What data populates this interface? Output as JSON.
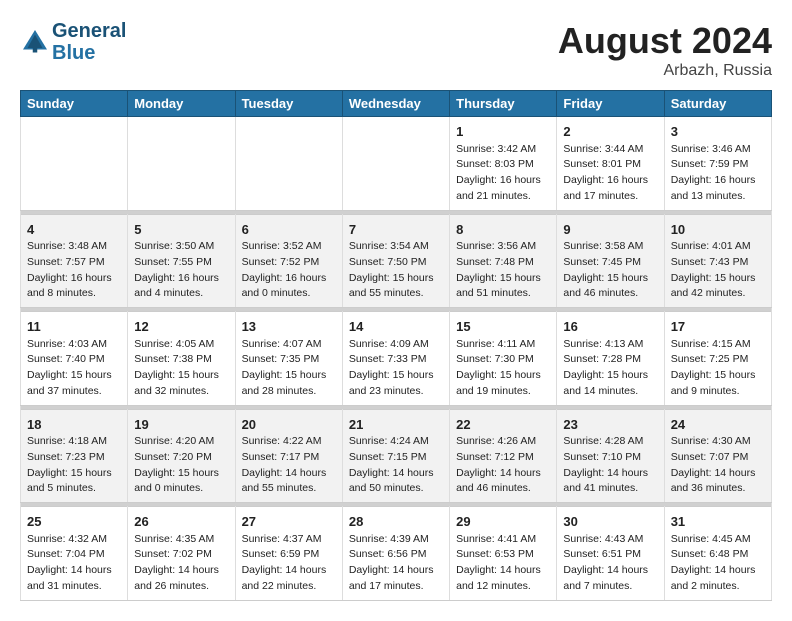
{
  "header": {
    "logo_line1": "General",
    "logo_line2": "Blue",
    "month": "August 2024",
    "location": "Arbazh, Russia"
  },
  "days_of_week": [
    "Sunday",
    "Monday",
    "Tuesday",
    "Wednesday",
    "Thursday",
    "Friday",
    "Saturday"
  ],
  "weeks": [
    {
      "cells": [
        {
          "day": null,
          "content": null
        },
        {
          "day": null,
          "content": null
        },
        {
          "day": null,
          "content": null
        },
        {
          "day": null,
          "content": null
        },
        {
          "day": "1",
          "sunrise": "Sunrise: 3:42 AM",
          "sunset": "Sunset: 8:03 PM",
          "daylight": "Daylight: 16 hours and 21 minutes."
        },
        {
          "day": "2",
          "sunrise": "Sunrise: 3:44 AM",
          "sunset": "Sunset: 8:01 PM",
          "daylight": "Daylight: 16 hours and 17 minutes."
        },
        {
          "day": "3",
          "sunrise": "Sunrise: 3:46 AM",
          "sunset": "Sunset: 7:59 PM",
          "daylight": "Daylight: 16 hours and 13 minutes."
        }
      ]
    },
    {
      "cells": [
        {
          "day": "4",
          "sunrise": "Sunrise: 3:48 AM",
          "sunset": "Sunset: 7:57 PM",
          "daylight": "Daylight: 16 hours and 8 minutes."
        },
        {
          "day": "5",
          "sunrise": "Sunrise: 3:50 AM",
          "sunset": "Sunset: 7:55 PM",
          "daylight": "Daylight: 16 hours and 4 minutes."
        },
        {
          "day": "6",
          "sunrise": "Sunrise: 3:52 AM",
          "sunset": "Sunset: 7:52 PM",
          "daylight": "Daylight: 16 hours and 0 minutes."
        },
        {
          "day": "7",
          "sunrise": "Sunrise: 3:54 AM",
          "sunset": "Sunset: 7:50 PM",
          "daylight": "Daylight: 15 hours and 55 minutes."
        },
        {
          "day": "8",
          "sunrise": "Sunrise: 3:56 AM",
          "sunset": "Sunset: 7:48 PM",
          "daylight": "Daylight: 15 hours and 51 minutes."
        },
        {
          "day": "9",
          "sunrise": "Sunrise: 3:58 AM",
          "sunset": "Sunset: 7:45 PM",
          "daylight": "Daylight: 15 hours and 46 minutes."
        },
        {
          "day": "10",
          "sunrise": "Sunrise: 4:01 AM",
          "sunset": "Sunset: 7:43 PM",
          "daylight": "Daylight: 15 hours and 42 minutes."
        }
      ]
    },
    {
      "cells": [
        {
          "day": "11",
          "sunrise": "Sunrise: 4:03 AM",
          "sunset": "Sunset: 7:40 PM",
          "daylight": "Daylight: 15 hours and 37 minutes."
        },
        {
          "day": "12",
          "sunrise": "Sunrise: 4:05 AM",
          "sunset": "Sunset: 7:38 PM",
          "daylight": "Daylight: 15 hours and 32 minutes."
        },
        {
          "day": "13",
          "sunrise": "Sunrise: 4:07 AM",
          "sunset": "Sunset: 7:35 PM",
          "daylight": "Daylight: 15 hours and 28 minutes."
        },
        {
          "day": "14",
          "sunrise": "Sunrise: 4:09 AM",
          "sunset": "Sunset: 7:33 PM",
          "daylight": "Daylight: 15 hours and 23 minutes."
        },
        {
          "day": "15",
          "sunrise": "Sunrise: 4:11 AM",
          "sunset": "Sunset: 7:30 PM",
          "daylight": "Daylight: 15 hours and 19 minutes."
        },
        {
          "day": "16",
          "sunrise": "Sunrise: 4:13 AM",
          "sunset": "Sunset: 7:28 PM",
          "daylight": "Daylight: 15 hours and 14 minutes."
        },
        {
          "day": "17",
          "sunrise": "Sunrise: 4:15 AM",
          "sunset": "Sunset: 7:25 PM",
          "daylight": "Daylight: 15 hours and 9 minutes."
        }
      ]
    },
    {
      "cells": [
        {
          "day": "18",
          "sunrise": "Sunrise: 4:18 AM",
          "sunset": "Sunset: 7:23 PM",
          "daylight": "Daylight: 15 hours and 5 minutes."
        },
        {
          "day": "19",
          "sunrise": "Sunrise: 4:20 AM",
          "sunset": "Sunset: 7:20 PM",
          "daylight": "Daylight: 15 hours and 0 minutes."
        },
        {
          "day": "20",
          "sunrise": "Sunrise: 4:22 AM",
          "sunset": "Sunset: 7:17 PM",
          "daylight": "Daylight: 14 hours and 55 minutes."
        },
        {
          "day": "21",
          "sunrise": "Sunrise: 4:24 AM",
          "sunset": "Sunset: 7:15 PM",
          "daylight": "Daylight: 14 hours and 50 minutes."
        },
        {
          "day": "22",
          "sunrise": "Sunrise: 4:26 AM",
          "sunset": "Sunset: 7:12 PM",
          "daylight": "Daylight: 14 hours and 46 minutes."
        },
        {
          "day": "23",
          "sunrise": "Sunrise: 4:28 AM",
          "sunset": "Sunset: 7:10 PM",
          "daylight": "Daylight: 14 hours and 41 minutes."
        },
        {
          "day": "24",
          "sunrise": "Sunrise: 4:30 AM",
          "sunset": "Sunset: 7:07 PM",
          "daylight": "Daylight: 14 hours and 36 minutes."
        }
      ]
    },
    {
      "cells": [
        {
          "day": "25",
          "sunrise": "Sunrise: 4:32 AM",
          "sunset": "Sunset: 7:04 PM",
          "daylight": "Daylight: 14 hours and 31 minutes."
        },
        {
          "day": "26",
          "sunrise": "Sunrise: 4:35 AM",
          "sunset": "Sunset: 7:02 PM",
          "daylight": "Daylight: 14 hours and 26 minutes."
        },
        {
          "day": "27",
          "sunrise": "Sunrise: 4:37 AM",
          "sunset": "Sunset: 6:59 PM",
          "daylight": "Daylight: 14 hours and 22 minutes."
        },
        {
          "day": "28",
          "sunrise": "Sunrise: 4:39 AM",
          "sunset": "Sunset: 6:56 PM",
          "daylight": "Daylight: 14 hours and 17 minutes."
        },
        {
          "day": "29",
          "sunrise": "Sunrise: 4:41 AM",
          "sunset": "Sunset: 6:53 PM",
          "daylight": "Daylight: 14 hours and 12 minutes."
        },
        {
          "day": "30",
          "sunrise": "Sunrise: 4:43 AM",
          "sunset": "Sunset: 6:51 PM",
          "daylight": "Daylight: 14 hours and 7 minutes."
        },
        {
          "day": "31",
          "sunrise": "Sunrise: 4:45 AM",
          "sunset": "Sunset: 6:48 PM",
          "daylight": "Daylight: 14 hours and 2 minutes."
        }
      ]
    }
  ]
}
